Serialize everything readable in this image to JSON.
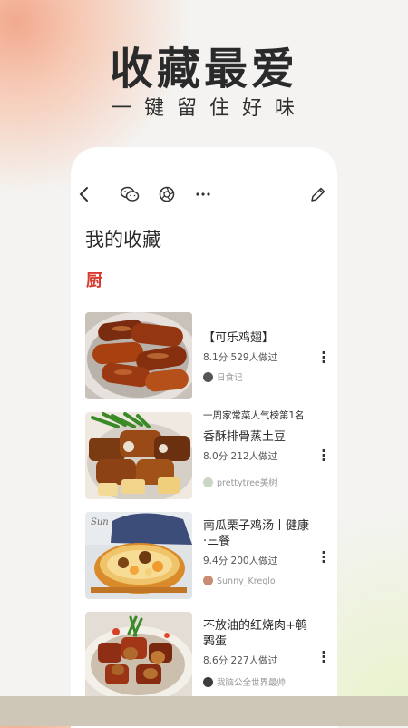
{
  "promo": {
    "headline": "收藏最爱",
    "subline": "一键留住好味"
  },
  "toolbar": {
    "back_icon": "chevron-left-icon",
    "wechat_icon": "wechat-icon",
    "moments_icon": "aperture-icon",
    "more_icon": "more-horizontal-icon",
    "edit_icon": "pencil-icon"
  },
  "page": {
    "title": "我的收藏",
    "logo": "厨"
  },
  "recipes": [
    {
      "name": "【可乐鸡翅】",
      "tag": "",
      "meta": "8.1分 529人做过",
      "author": "日食记",
      "photo": "cola-chicken-wings"
    },
    {
      "name": "香酥排骨蒸土豆",
      "tag": "一周家常菜人气榜第1名",
      "meta": "8.0分 212人做过",
      "author": "prettytree美树",
      "photo": "ribs-potato"
    },
    {
      "name": "南瓜栗子鸡汤丨健康·三餐",
      "tag": "",
      "meta": "9.4分 200人做过",
      "author": "Sunny_Kreglo",
      "photo": "pumpkin-chestnut-soup"
    },
    {
      "name": "不放油的红烧肉+鹌鹑蛋",
      "tag": "",
      "meta": "8.6分 227人做过",
      "author": "我脑公全世界最帅",
      "photo": "braised-pork-eggs"
    }
  ],
  "colors": {
    "accent": "#d63b2f",
    "peach": "#f2a98e",
    "strip": "#cec6b6"
  }
}
